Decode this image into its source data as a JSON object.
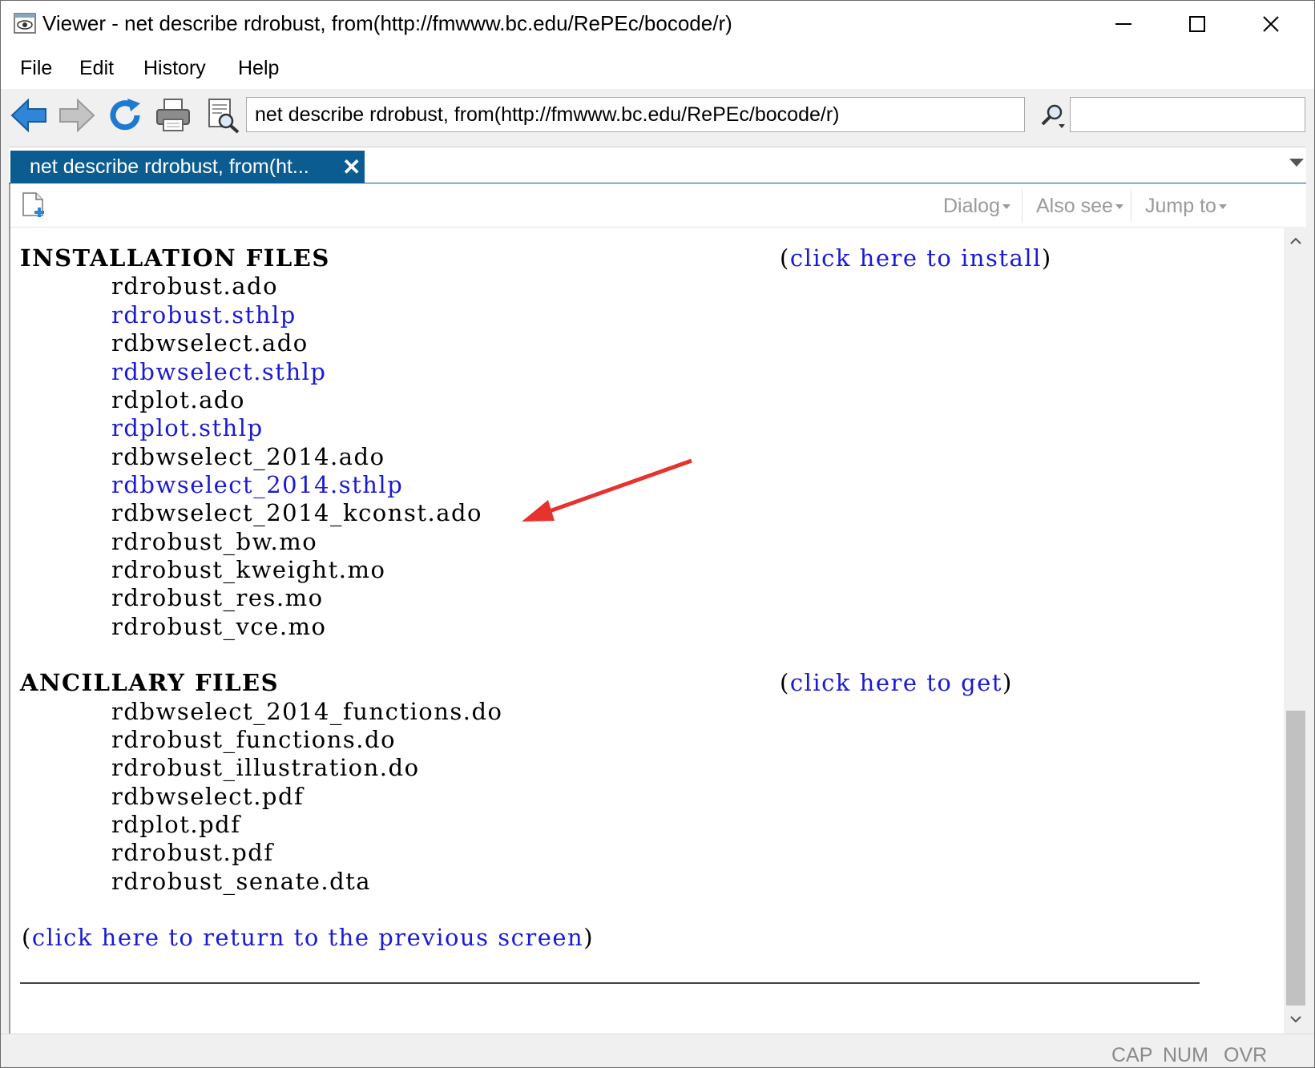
{
  "window": {
    "title": "Viewer - net describe rdrobust, from(http://fmwww.bc.edu/RePEc/bocode/r)"
  },
  "menu": [
    "File",
    "Edit",
    "History",
    "Help"
  ],
  "toolbar": {
    "command_value": "net describe rdrobust, from(http://fmwww.bc.edu/RePEc/bocode/r)",
    "search_value": "",
    "icons": [
      "back-arrow-icon",
      "forward-arrow-icon",
      "refresh-icon",
      "print-icon",
      "find-document-icon",
      "search-icon"
    ]
  },
  "tab": {
    "label": "net describe rdrobust, from(ht...",
    "close_symbol": "✕"
  },
  "helpbar": {
    "dialog": "Dialog",
    "also_see": "Also see",
    "jump_to": "Jump to"
  },
  "installation": {
    "header": "INSTALLATION FILES",
    "link_open": "(",
    "link_text": "click here to install",
    "link_close": ")",
    "files": [
      {
        "name": "rdrobust.ado",
        "link": false
      },
      {
        "name": "rdrobust.sthlp",
        "link": true
      },
      {
        "name": "rdbwselect.ado",
        "link": false
      },
      {
        "name": "rdbwselect.sthlp",
        "link": true
      },
      {
        "name": "rdplot.ado",
        "link": false
      },
      {
        "name": "rdplot.sthlp",
        "link": true
      },
      {
        "name": "rdbwselect_2014.ado",
        "link": false
      },
      {
        "name": "rdbwselect_2014.sthlp",
        "link": true
      },
      {
        "name": "rdbwselect_2014_kconst.ado",
        "link": false
      },
      {
        "name": "rdrobust_bw.mo",
        "link": false
      },
      {
        "name": "rdrobust_kweight.mo",
        "link": false
      },
      {
        "name": "rdrobust_res.mo",
        "link": false
      },
      {
        "name": "rdrobust_vce.mo",
        "link": false
      }
    ]
  },
  "ancillary": {
    "header": "ANCILLARY FILES",
    "link_open": "(",
    "link_text": "click here to get",
    "link_close": ")",
    "files": [
      "rdbwselect_2014_functions.do",
      "rdrobust_functions.do",
      "rdrobust_illustration.do",
      "rdbwselect.pdf",
      "rdplot.pdf",
      "rdrobust.pdf",
      "rdrobust_senate.dta"
    ]
  },
  "footer": {
    "link_open": "(",
    "link_text": "click here to return to the previous screen",
    "link_close": ")"
  },
  "status": [
    "CAP",
    "NUM",
    "OVR"
  ],
  "colors": {
    "tab_bg": "#0b5d91",
    "link": "#1a1ad6",
    "annotation_arrow": "#e8322e"
  }
}
